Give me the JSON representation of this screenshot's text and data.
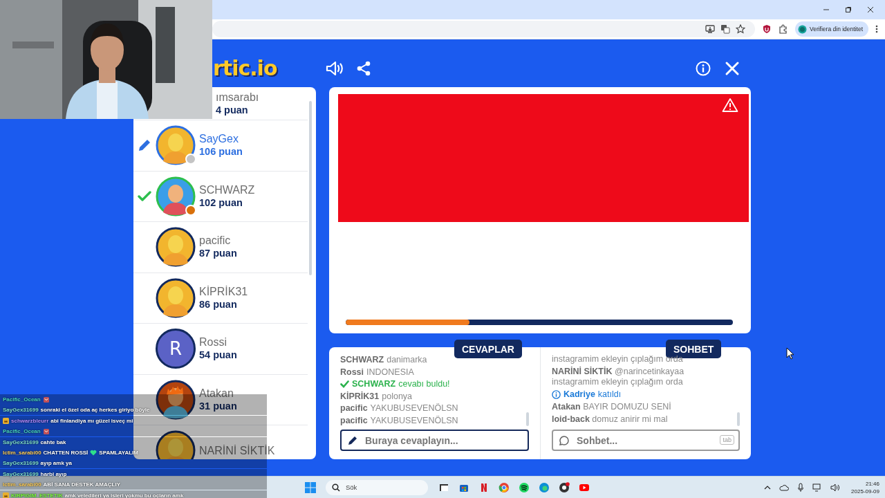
{
  "browser": {
    "profile_button": "Verifiera din identitet"
  },
  "game": {
    "logo": "rtic.io",
    "players": [
      {
        "name": "ımsarabı",
        "points": "4 puan",
        "kind": "hidden",
        "drawing": false,
        "guessed": false
      },
      {
        "name": "SayGex",
        "points": "106 puan",
        "kind": "yellow",
        "drawing": true,
        "guessed": false,
        "color": "#c4c4c4"
      },
      {
        "name": "SCHWARZ",
        "points": "102 puan",
        "kind": "blue",
        "drawing": false,
        "guessed": true,
        "color": "#d9700b"
      },
      {
        "name": "pacific",
        "points": "87 puan",
        "kind": "yellow",
        "drawing": false,
        "guessed": false
      },
      {
        "name": "KİPRİK31",
        "points": "86 puan",
        "kind": "yellow",
        "drawing": false,
        "guessed": false
      },
      {
        "name": "Rossi",
        "points": "54 puan",
        "kind": "letter",
        "letter": "R",
        "drawing": false,
        "guessed": false
      },
      {
        "name": "Atakan",
        "points": "31 puan",
        "kind": "redhead",
        "drawing": false,
        "guessed": false
      },
      {
        "name": "NARİNİ SİKTİK",
        "kind": "yellow",
        "drawing": false,
        "guessed": false
      }
    ],
    "timer": {
      "level": 0.32
    },
    "answers_tab": "CEVAPLAR",
    "chat_tab": "SOHBET",
    "answers": [
      {
        "kind": "answer",
        "name": "SCHWARZ",
        "text": "danimarka"
      },
      {
        "kind": "answer",
        "name": "Rossi",
        "text": "INDONESIA"
      },
      {
        "kind": "found",
        "name": "SCHWARZ",
        "text": "cevabı buldu!"
      },
      {
        "kind": "answer",
        "name": "KİPRİK31",
        "text": "polonya"
      },
      {
        "kind": "answer",
        "name": "pacific",
        "text": "YAKUBUSEVENÖLSN"
      },
      {
        "kind": "answer",
        "name": "pacific",
        "text": "YAKUBUSEVENÖLSN"
      }
    ],
    "answer_input": {
      "placeholder": "Buraya cevaplayın..."
    },
    "chat": [
      {
        "kind": "message",
        "text": "instagramim ekleyin çıplağım orda"
      },
      {
        "kind": "message",
        "name": "NARİNİ SİKTİK",
        "text": "@narincetinkayaa instagramim ekleyin çıplağım orda"
      },
      {
        "kind": "join",
        "name": "Kadriye",
        "text": "katıldı"
      },
      {
        "kind": "message",
        "name": "Atakan",
        "text": "BAYIR DOMUZU SENİ"
      },
      {
        "kind": "message",
        "name": "loid-back",
        "text": "domuz anirir mi mal"
      }
    ],
    "chat_input": {
      "placeholder": "Sohbet...",
      "key_hint": "tab"
    }
  },
  "stream_chat": [
    {
      "kind": "emote",
      "user": "Pacific_Ocean",
      "color": "#48d6c0"
    },
    {
      "kind": "text",
      "user": "SayGex31699",
      "color": "#7fe0cf",
      "text": "sonraki el özel oda aç herkes giriyo böyle"
    },
    {
      "kind": "text",
      "user": "schwarzbleurr",
      "color": "#b48cff",
      "badge": true,
      "text": "abi finlandiya mı güzel isveç mi"
    },
    {
      "kind": "emote",
      "user": "Pacific_Ocean",
      "color": "#48d6c0"
    },
    {
      "kind": "text",
      "user": "SayGex31699",
      "color": "#7fe0cf",
      "text": "cahte bak"
    },
    {
      "kind": "text",
      "user": "lctim_sarabi00",
      "color": "#ffcf5a",
      "text": "CHATTEN ROSSİ",
      "heart": true,
      "text_2": "SPAMLAYALIM"
    },
    {
      "kind": "text",
      "user": "SayGex31699",
      "color": "#7fe0cf",
      "text": "ayıp amk ya"
    },
    {
      "kind": "text",
      "user": "SayGex31699",
      "color": "#7fe0cf",
      "text": "harbi ayıp"
    },
    {
      "kind": "text",
      "user": "lctim_sarabi00",
      "color": "#ffcf5a",
      "text": "ABİ SANA DESTEK AMAÇLIY"
    },
    {
      "kind": "text",
      "user": "KIRPIGIM_ESTETIK",
      "color": "#7dff3a",
      "badge": true,
      "text": "amk veledileri ya isleri yokmu bu oçların amk"
    }
  ],
  "taskbar": {
    "search": "Sök",
    "time": "21:46",
    "date": "2025-09-09"
  }
}
